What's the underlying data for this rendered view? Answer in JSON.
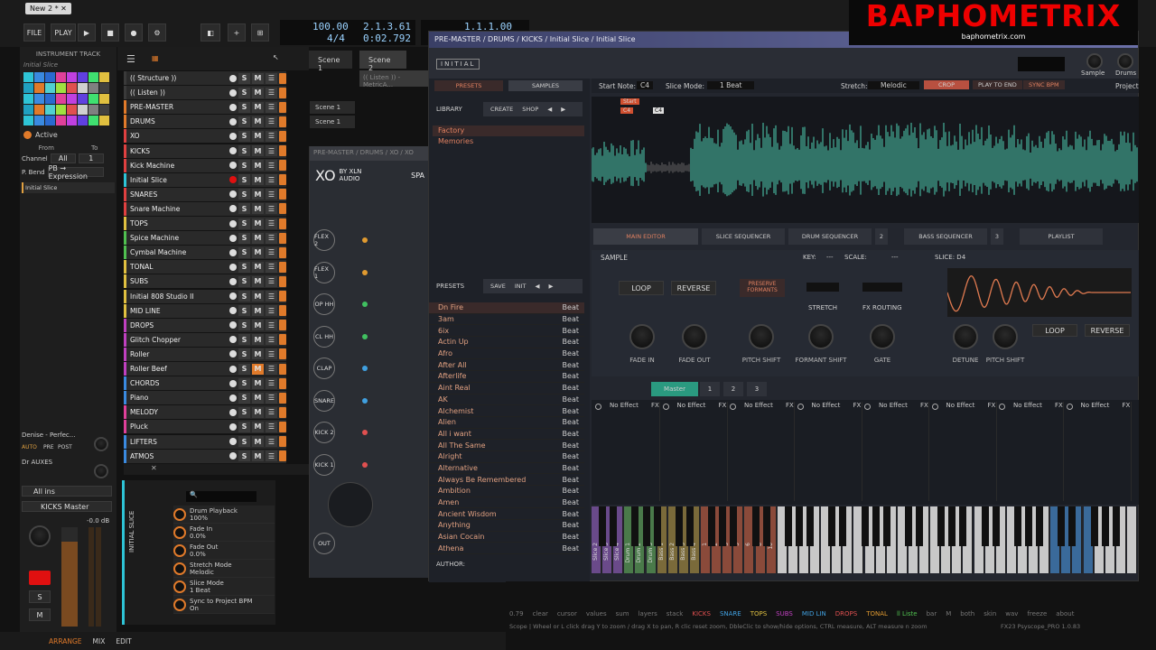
{
  "daw": {
    "tab": "New 2 *",
    "file": "FILE",
    "play": "PLAY",
    "tempo": "100.00",
    "sig": "4/4",
    "pos": "2.1.3.61",
    "time": "0:02.792",
    "loop_pos": "1.1.1.00"
  },
  "instrument": {
    "header": "INSTRUMENT TRACK",
    "name": "Initial Slice",
    "active": "Active",
    "from": "From",
    "to": "To",
    "channel": "Channel",
    "chan_val": "All",
    "to_val": "1",
    "pbend": "P. Bend",
    "pbexp": "PB → Expression",
    "slot": "Initial Slice",
    "bus1": "Denise - Perfec...",
    "bus2": "Dr AUXES",
    "bus_btns": [
      "AUTO",
      "PRE",
      "POST"
    ],
    "allins": "All ins",
    "kicks_master": "KICKS Master",
    "db": "-0.0 dB",
    "ms": "M",
    "ss": "S"
  },
  "tracks": [
    "(( Structure ))",
    "(( Listen ))",
    "PRE-MASTER",
    "DRUMS",
    "XO",
    "KICKS",
    "Kick Machine",
    "Initial Slice",
    "SNARES",
    "Snare Machine",
    "TOPS",
    "Spice Machine",
    "Cymbal Machine",
    "TONAL",
    "SUBS",
    "Initial 808 Studio II",
    "MID LINE",
    "DROPS",
    "Glitch Chopper",
    "Roller",
    "Roller Beef",
    "CHORDS",
    "Piano",
    "MELODY",
    "Pluck",
    "LIFTERS",
    "ATMOS"
  ],
  "scenes": [
    "Scene 1",
    "Scene 2",
    "S",
    "Scene 1",
    "Scene 1"
  ],
  "listen": "(( Listen )) - MetricA...",
  "xo": {
    "path": "PRE-MASTER / DRUMS / XO / XO",
    "brand": "BY XLN",
    "brand2": "AUDIO",
    "sp": "SPA",
    "channels": [
      "FLEX 2",
      "FLEX 1",
      "OP HH",
      "CL HH",
      "CLAP",
      "SNARE",
      "KICK 2",
      "KICK 1"
    ],
    "out": "OUT"
  },
  "initial": {
    "path": "PRE-MASTER / DRUMS / KICKS / Initial Slice / Initial Slice",
    "logo": "INITIAL",
    "presets_tab": "PRESETS",
    "samples_tab": "SAMPLES",
    "library": "LIBRARY",
    "create": "CREATE",
    "shop": "SHOP",
    "lib_items": [
      "Factory",
      "Memories"
    ],
    "start_note": "Start Note:",
    "start_val": "C4",
    "slice_mode": "Slice Mode:",
    "slice_val": "1 Beat",
    "stretch": "Stretch:",
    "stretch_val": "Melodic",
    "crop": "CROP",
    "play_end": "PLAY TO END",
    "sync": "SYNC BPM",
    "sample_btn": "Sample",
    "drums_btn": "Drums",
    "project": "Project",
    "start": "Start",
    "c4": "C4",
    "c4b": "C4",
    "tabs": [
      "MAIN EDITOR",
      "SLICE SEQUENCER",
      "DRUM SEQUENCER",
      "2",
      "BASS SEQUENCER",
      "3",
      "PLAYLIST"
    ],
    "sample": "SAMPLE",
    "key": "KEY:",
    "key_val": "---",
    "scale": "SCALE:",
    "scale_val": "---",
    "slice": "SLICE: D4",
    "loop": "LOOP",
    "reverse": "REVERSE",
    "preserve": "PRESERVE FORMANTS",
    "stretch_lbl": "STRETCH",
    "fxr": "FX ROUTING",
    "knobs": [
      "FADE IN",
      "FADE OUT",
      "PITCH SHIFT",
      "FORMANT SHIFT",
      "GATE",
      "DETUNE",
      "PITCH SHIFT"
    ],
    "loop2": "LOOP",
    "reverse2": "REVERSE",
    "presets_hdr": "PRESETS",
    "save": "SAVE",
    "init": "INIT",
    "presets": [
      "Dn Fire",
      "3am",
      "6ix",
      "Actin Up",
      "Afro",
      "After All",
      "Afterlife",
      "Aint Real",
      "AK",
      "Alchemist",
      "Alien",
      "All i want",
      "All The Same",
      "Alright",
      "Alternative",
      "Always Be Remembered",
      "Ambition",
      "Amen",
      "Ancient Wisdom",
      "Anything",
      "Asian Cocain",
      "Athena"
    ],
    "beat": "Beat",
    "author": "AUTHOR:",
    "fx_tabs": [
      "Master",
      "1",
      "2",
      "3"
    ],
    "noeffect": "No Effect",
    "fx": "FX",
    "keys": [
      "Slice 2",
      "Slice 3",
      "Slice 4",
      "Drum 1",
      "Drum 2",
      "Drum 3",
      "Bass 1",
      "Bass 2",
      "Bass 3",
      "Bass 4",
      "1",
      "2",
      "3",
      "5",
      "6",
      "8",
      "10"
    ]
  },
  "bphm": {
    "title": "BAPHOMETRIX",
    "url": "baphometrix.com"
  },
  "scope": {
    "labels": [
      "0.79",
      "clear",
      "cursor",
      "values",
      "sum",
      "layers",
      "stack",
      "KICKS",
      "SNARE",
      "TOPS",
      "SUBS",
      "MID LIN",
      "DROPS",
      "TONAL",
      "ll Liste",
      "bar",
      "M",
      "both",
      "skin",
      "wav",
      "freeze",
      "about"
    ],
    "help": "Scope | Wheel or L click drag Y to zoom / drag X to pan, R clic reset zoom, DbleClic to show/hide options, CTRL measure, ALT measure n zoom",
    "ver": "FX23 Psyscope_PRO 1.0.83"
  },
  "quick": {
    "items": [
      {
        "n": "Drum Playback",
        "v": "100%"
      },
      {
        "n": "Fade In",
        "v": "0.0%"
      },
      {
        "n": "Fade Out",
        "v": "0.0%"
      },
      {
        "n": "Stretch Mode",
        "v": "Melodic"
      },
      {
        "n": "Slice Mode",
        "v": "1 Beat"
      },
      {
        "n": "Sync to Project BPM",
        "v": "On"
      }
    ],
    "side": "INITIAL SLICE"
  },
  "bottom": {
    "arrange": "ARRANGE",
    "mix": "MIX",
    "edit": "EDIT"
  }
}
